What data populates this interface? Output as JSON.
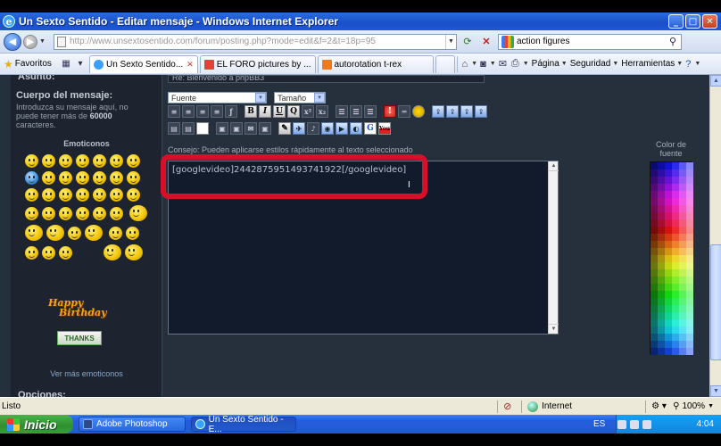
{
  "window": {
    "title": "Un Sexto Sentido - Editar mensaje - Windows Internet Explorer"
  },
  "address_bar": {
    "url": "http://www.unsextosentido.com/forum/posting.php?mode=edit&f=2&t=18p=95",
    "search_value": "action figures"
  },
  "tab_bar": {
    "favorites_label": "Favoritos",
    "tabs": [
      {
        "label": "Un Sexto Sentido...",
        "active": true
      },
      {
        "label": "EL FORO pictures by ...",
        "active": false
      },
      {
        "label": "autorotation t-rex",
        "active": false
      }
    ],
    "commands": {
      "page": "Página",
      "security": "Seguridad",
      "tools": "Herramientas"
    }
  },
  "form": {
    "subject_label": "Asunto:",
    "subject_value": "Re: Bienvenido a phpBB3",
    "body_label": "Cuerpo del mensaje:",
    "body_desc_pre": "Introduzca su mensaje aquí, no puede tener más de ",
    "body_desc_max": "60000",
    "body_desc_post": " caracteres.",
    "emoticons_title": "Emoticonos",
    "more_emoticons": "Ver más emoticonos",
    "birthday_line1": "Happy",
    "birthday_line2": "Birthday",
    "thanks_text": "THANKS",
    "font_select": "Fuente",
    "size_select": "Tamaño",
    "tip": "Consejo: Pueden aplicarse estilos rápidamente al texto seleccionado",
    "message_text": "[googlevideo]2442875951493741922[/googlevideo]",
    "font_color_label": "Color de fuente",
    "options_label": "Opciones:",
    "toolbar_buttons": [
      "B",
      "I",
      "U",
      "Q",
      "x²",
      "x₂"
    ]
  },
  "status_bar": {
    "status": "Listo",
    "zone": "Internet",
    "zoom": "100%"
  },
  "taskbar": {
    "start_label": "Inicio",
    "items": [
      {
        "label": "Adobe Photoshop",
        "active": false
      },
      {
        "label": "Un Sexto Sentido - E...",
        "active": true
      }
    ],
    "lang": "ES",
    "clock": "4:04"
  },
  "colors": {
    "page_bg": "#26303d",
    "highlight": "#d6102a",
    "xp_blue": "#245edc",
    "start_green": "#2e8f2e"
  }
}
